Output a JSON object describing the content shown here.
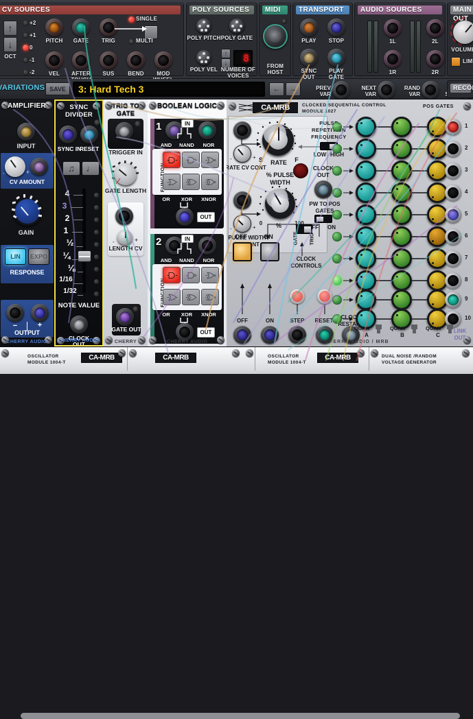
{
  "top": {
    "cv_sources": {
      "title": "CV SOURCES",
      "oct_label": "OCT",
      "oct_values": [
        "+2",
        "+1",
        "0",
        "-1",
        "-2"
      ],
      "oct_selected": "0",
      "single_label": "SINGLE",
      "multi_label": "MULTI",
      "jacks": [
        "PITCH",
        "GATE",
        "TRIG",
        "VEL",
        "AFTER TOUCH",
        "SUS",
        "BEND",
        "MOD WHEEL"
      ]
    },
    "poly_sources": {
      "title": "POLY SOURCES",
      "jacks": [
        "POLY PITCH",
        "POLY GATE",
        "POLY VEL"
      ],
      "voices_label": "NUMBER OF VOICES",
      "voices_value": "8"
    },
    "midi": {
      "title": "MIDI",
      "jack": "FROM HOST"
    },
    "transport": {
      "title": "TRANSPORT",
      "jacks": [
        "PLAY",
        "STOP",
        "SYNC OUT",
        "PLAY GATE"
      ]
    },
    "audio_sources": {
      "title": "AUDIO SOURCES",
      "jacks": [
        "1L",
        "2L",
        "1R",
        "2R"
      ]
    },
    "main_out": {
      "title": "MAIN OUT",
      "volume_label": "VOLUME",
      "limiter_label": "LIMITER"
    }
  },
  "variations": {
    "title": "VARIATIONS",
    "save_label": "SAVE",
    "current": "3: Hard Tech 3",
    "prev_label": "PREV VAR",
    "next_label": "NEXT VAR",
    "rand_label": "RAND VAR",
    "cv_label": "CV SEL",
    "record_label": "RECORD"
  },
  "modules": {
    "amplifier": {
      "name": "AMPLIFIER",
      "input_label": "INPUT",
      "cv_amount_label": "CV AMOUNT",
      "gain_label": "GAIN",
      "response_label": "RESPONSE",
      "response_options": [
        "LIN",
        "EXPO"
      ],
      "response_selected": "LIN",
      "output_label": "OUTPUT",
      "output_minus": "−",
      "output_plus": "+",
      "brand": "CHERRY AUDIO"
    },
    "sync_divider": {
      "name": "SYNC DIVIDER",
      "sync_in_label": "SYNC IN",
      "reset_label": "RESET",
      "note_value_label": "NOTE VALUE",
      "scale": [
        "4",
        "3",
        "2",
        "1",
        "½",
        "¼",
        "⅛",
        "1/16",
        "1/32"
      ],
      "clock_out_label": "CLOCK OUT",
      "brand": "CHERRY AUDIO"
    },
    "trig_to_gate": {
      "name": "TRIG TO GATE",
      "trigger_in_label": "TRIGGER IN",
      "gate_length_label": "GATE LENGTH",
      "length_cv_label": "LENGTH CV",
      "gate_out_label": "GATE OUT",
      "brand": "CHERRY"
    },
    "boolean_logic": {
      "name": "BOOLEAN LOGIC",
      "in_label": "IN",
      "out_label": "OUT",
      "function_label": "FUNCTION",
      "top_labels": [
        "AND",
        "NAND",
        "NOR"
      ],
      "bottom_labels": [
        "OR",
        "XOR",
        "XNOR"
      ],
      "sections": [
        {
          "index": "1",
          "selected": "AND"
        },
        {
          "index": "2",
          "selected": "AND"
        }
      ],
      "brand": "CHERRY AUDIO"
    },
    "clocked_seq": {
      "brand_logo": "CA-MRB",
      "name_line1": "CLOCKED SEQUENTIAL CONTROL",
      "name_line2": "MODULE 1027",
      "rate_cv_label": "RATE CV CONT",
      "rate_label": "RATE",
      "rate_min": "S",
      "rate_max": "F",
      "pulse_rep_label": "PULSE REPETITION FREQUENCY",
      "low_high": [
        "LOW",
        "HIGH"
      ],
      "pulse_width_label": "% PULSE WIDTH",
      "pulse_width_min": "0",
      "pulse_width_unit": "%",
      "pulse_width_max": "100",
      "pulse_width_cv_label": "PULSE WIDTH CV CONT",
      "clock_out_label": "CLOCK OUT",
      "pw_to_pos_label": "PW TO POS GATES",
      "pw_off": "OFF",
      "pw_on": "ON",
      "clock_controls_label": "CLOCK CONTROLS",
      "clock_mode": [
        "GATE",
        "TRIG"
      ],
      "lamp_off_label": "OFF",
      "lamp_on_label": "ON",
      "jack_labels": [
        "OFF",
        "ON",
        "STEP",
        "RESET",
        "CLOCK RESTART"
      ],
      "btn_labels": [
        "STEP",
        "RESET"
      ],
      "pos_gates_label": "POS GATES",
      "quan_label": "QUAN",
      "bus_labels": [
        "A",
        "B",
        "C"
      ],
      "link_out_label": "LINK OUT",
      "brand": "CHERRY AUDIO / MRB",
      "positions": [
        "1",
        "2",
        "3",
        "4",
        "5",
        "6",
        "7",
        "8",
        "9",
        "10"
      ]
    }
  },
  "bottom_rack": {
    "items": [
      {
        "line1": "OSCILLATOR",
        "line2": "MODULE 1004-T",
        "logo": "CA-MRB"
      },
      {
        "line1": "",
        "line2": "",
        "logo": "CA-MRB"
      },
      {
        "line1": "OSCILLATOR",
        "line2": "MODULE 1004-T",
        "logo": "CA-MRB"
      },
      {
        "line1": "DUAL NOISE /RANDOM",
        "line2": "VOLTAGE GENERATOR",
        "logo": ""
      }
    ]
  },
  "colors": {
    "accent_cv": "#a24a44",
    "accent_midi": "#3f9e84",
    "accent_transport": "#5b93c9",
    "accent_audio": "#9c6f93",
    "variation_text": "#f5d020",
    "variation_title": "#56c9e8",
    "selected_logic": "#e42218",
    "module_highlight": "#f2e14a"
  }
}
